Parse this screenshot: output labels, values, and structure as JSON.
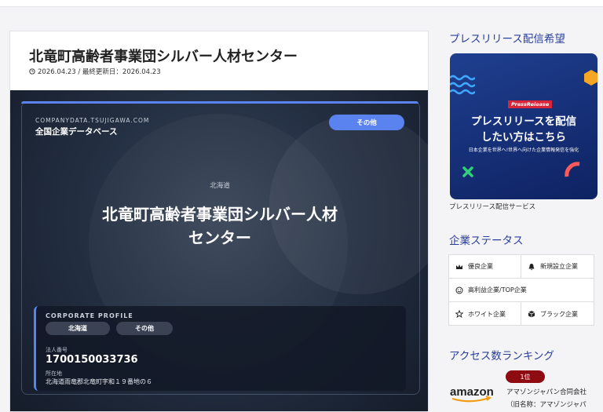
{
  "article": {
    "title": "北竜町高齢者事業団シルバー人材センター",
    "meta": "2026.04.23 / 最終更新日：2026.04.23"
  },
  "hero": {
    "site": "COMPANYDATA.TSUJIGAWA.COM",
    "database": "全国企業データベース",
    "category_pill": "その他",
    "region": "北海道",
    "company_name": "北竜町高齢者事業団シルバー人材センター",
    "profile": {
      "label": "CORPORATE PROFILE",
      "chips": [
        "北海道",
        "その他"
      ],
      "number_label": "法人番号",
      "number": "1700150033736",
      "address_label": "所在地",
      "address": "北海道雨竜郡北竜町字和１９番地の６"
    },
    "accent_color": "#5b83f0"
  },
  "sidebar": {
    "press_heading": "プレスリリース配信希望",
    "banner": {
      "tag": "PressRelease",
      "line1": "プレスリリースを配信",
      "line2": "したい方はこちら",
      "sub": "日本企業を世界へ!世界へ向けた企業情報発信を強化"
    },
    "banner_caption": "プレスリリース配信サービス",
    "status_heading": "企業ステータス",
    "status_items": [
      {
        "label": "優良企業",
        "icon": "crown-icon"
      },
      {
        "label": "新規設立企業",
        "icon": "bell-icon"
      },
      {
        "label": "高利益企業/TOP企業",
        "icon": "smile-icon"
      },
      {
        "label": "ホワイト企業",
        "icon": "star-outline-icon"
      },
      {
        "label": "ブラック企業",
        "icon": "cube-icon"
      }
    ],
    "ranking_heading": "アクセス数ランキング",
    "ranking": {
      "badge": "1位",
      "logo_text": "amazon",
      "name": "アマゾンジャパン合同会社",
      "old_name": "（旧名称：アマゾンジャパ"
    }
  },
  "colors": {
    "heading_blue": "#2a3f9a",
    "rank_red": "#8f0b12",
    "banner_blue": "#1f3f8f"
  }
}
